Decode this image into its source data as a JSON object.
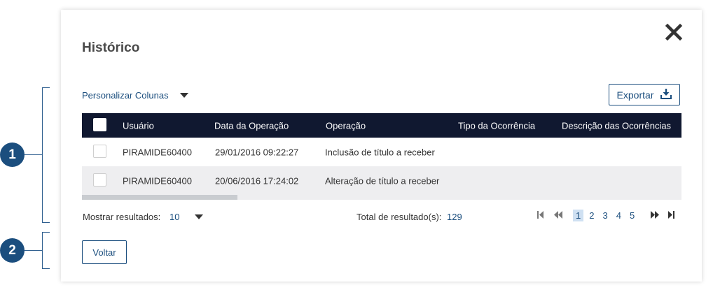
{
  "markers": [
    "1",
    "2"
  ],
  "dialog": {
    "title": "Histórico",
    "customize_columns": "Personalizar Colunas",
    "export_label": "Exportar",
    "back_label": "Voltar"
  },
  "table": {
    "columns": [
      "Usuário",
      "Data da Operação",
      "Operação",
      "Tipo da Ocorrência",
      "Descrição das Ocorrências"
    ],
    "rows": [
      {
        "user": "PIRAMIDE60400",
        "date": "29/01/2016 09:22:27",
        "operation": "Inclusão de título a receber"
      },
      {
        "user": "PIRAMIDE60400",
        "date": "20/06/2016 17:24:02",
        "operation": "Alteração de título a receber"
      }
    ]
  },
  "footer": {
    "show_results_label": "Mostrar resultados:",
    "show_results_value": "10",
    "total_label": "Total de resultado(s):",
    "total_value": "129"
  },
  "pagination": {
    "pages": [
      "1",
      "2",
      "3",
      "4",
      "5"
    ],
    "active_page": "1"
  },
  "icons": {
    "close": "close-icon",
    "export": "download-icon",
    "first": "first-page-icon",
    "prev": "previous-page-icon",
    "next": "next-page-icon",
    "last": "last-page-icon"
  },
  "colors": {
    "accent": "#1b4e7e",
    "header_bg": "#101830",
    "alt_row": "#eeeef0",
    "active_page_bg": "#cfe0f2"
  }
}
